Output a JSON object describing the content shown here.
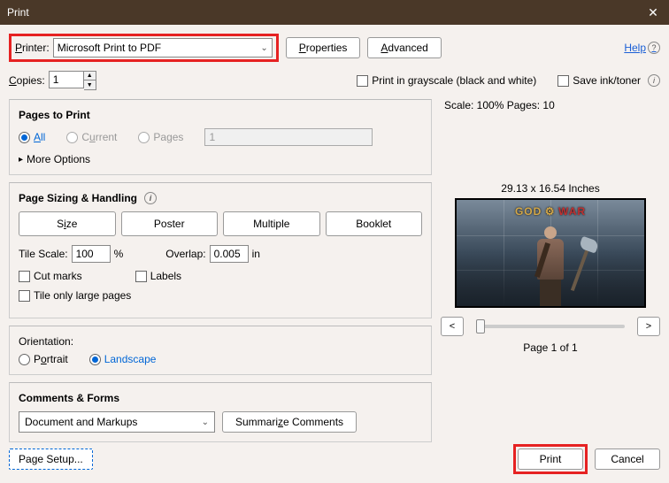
{
  "title": "Print",
  "header": {
    "printer_label": "Printer:",
    "printer_value": "Microsoft Print to PDF",
    "properties_btn": "Properties",
    "advanced_btn": "Advanced",
    "help_link": "Help"
  },
  "row2": {
    "copies_label": "Copies:",
    "copies_value": "1",
    "grayscale_label": "Print in grayscale (black and white)",
    "saveink_label": "Save ink/toner"
  },
  "pages": {
    "section_title": "Pages to Print",
    "all": "All",
    "current": "Current",
    "pages": "Pages",
    "pages_value": "1",
    "more_options": "More Options"
  },
  "handling": {
    "section_title": "Page Sizing & Handling",
    "size": "Size",
    "poster": "Poster",
    "multiple": "Multiple",
    "booklet": "Booklet",
    "tile_scale_label": "Tile Scale:",
    "tile_scale_value": "100",
    "tile_scale_unit": "%",
    "overlap_label": "Overlap:",
    "overlap_value": "0.005",
    "overlap_unit": "in",
    "cut_marks": "Cut marks",
    "labels": "Labels",
    "tile_large": "Tile only large pages"
  },
  "orientation": {
    "section_title": "Orientation:",
    "portrait": "Portrait",
    "landscape": "Landscape"
  },
  "comments": {
    "section_title": "Comments & Forms",
    "combo_value": "Document and Markups",
    "summarize_btn": "Summarize Comments"
  },
  "preview": {
    "scale_info": "Scale: 100% Pages: 10",
    "dimensions": "29.13 x 16.54 Inches",
    "logo_god": "GOD",
    "logo_war": "WAR",
    "prev": "<",
    "next": ">",
    "page_info": "Page 1 of 1"
  },
  "footer": {
    "page_setup": "Page Setup...",
    "print": "Print",
    "cancel": "Cancel"
  }
}
